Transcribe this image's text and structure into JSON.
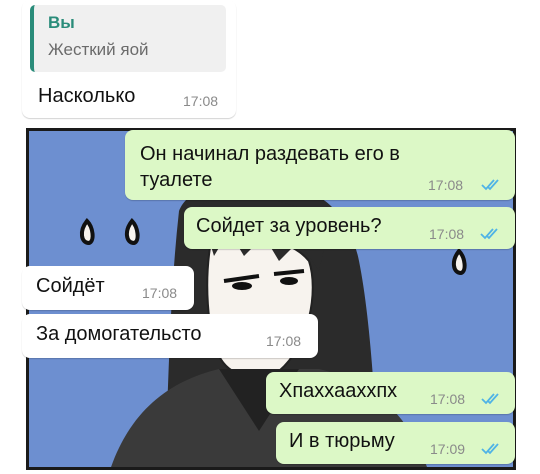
{
  "colors": {
    "incoming_bubble": "#ffffff",
    "outgoing_bubble": "#dcf8c6",
    "quote_accent": "#2a8c7a",
    "read_ticks": "#4fb3e6",
    "comic_background": "#6d8fd0"
  },
  "reply": {
    "author": "Вы",
    "quoted_text": "Жесткий яой",
    "text": "Насколько",
    "time": "17:08"
  },
  "messages": [
    {
      "direction": "out",
      "text_line1": "Он начинал раздевать его в",
      "text_line2": "туалете",
      "time": "17:08",
      "status": "read"
    },
    {
      "direction": "out",
      "text": "Сойдет за уровень?",
      "time": "17:08",
      "status": "read"
    },
    {
      "direction": "in",
      "text": "Сойдёт",
      "time": "17:08"
    },
    {
      "direction": "in",
      "text": "За домогательсто",
      "time": "17:08"
    },
    {
      "direction": "out",
      "text": "Хпаххааххпх",
      "time": "17:08",
      "status": "read"
    },
    {
      "direction": "out",
      "text": "И в тюрьму",
      "time": "17:09",
      "status": "read"
    }
  ],
  "icons": {
    "read_status": "double-check-icon"
  }
}
